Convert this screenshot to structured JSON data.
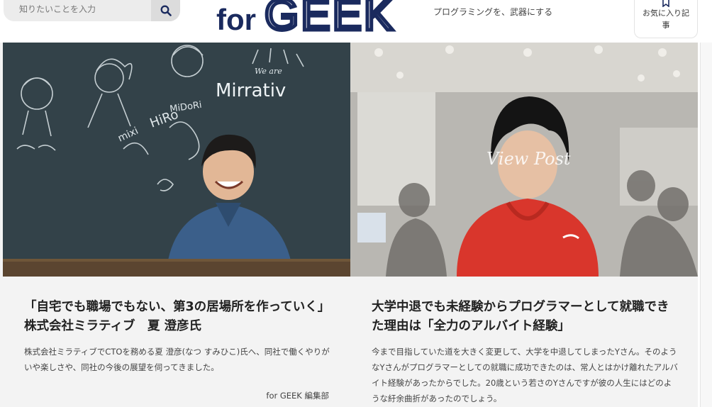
{
  "header": {
    "search": {
      "placeholder": "知りたいことを入力",
      "icon": "search-icon"
    },
    "logo": {
      "for_text": "for",
      "brand_text": "GEEK",
      "color": "#1a2a5e"
    },
    "tagline": "プログラミングを、武器にする",
    "favorites": {
      "icon": "bookmark-icon",
      "label": "お気に入り記事"
    }
  },
  "articles": [
    {
      "title": "「自宅でも職場でもない、第3の居場所を作っていく」株式会社ミラティブ　夏 澄彦氏",
      "description": "株式会社ミラティブでCTOを務める夏 澄彦(なつ すみひこ)氏へ、同社で働くやりがいや楽しさや、同社の今後の展望を伺ってきました。",
      "author": "for GEEK 編集部",
      "image": {
        "chalkboard_text": "Mirrativ",
        "chalkboard_subtext": "We are",
        "chalk_words": [
          "MiDoRi",
          "HiRo",
          "mixi"
        ]
      }
    },
    {
      "title": "大学中退でも未経験からプログラマーとして就職できた理由は「全力のアルバイト経験」",
      "description": "今まで目指していた道を大きく変更して、大学を中退してしまったYさん。そのようなYさんがプログラマーとしての就職に成功できたのは、常人とはかけ離れたアルバイト経験があったからでした。20歳という若さのYさんですが彼の人生にはどのような紆余曲折があったのでしょう。",
      "image": {
        "overlay_text": "View Post"
      }
    }
  ]
}
